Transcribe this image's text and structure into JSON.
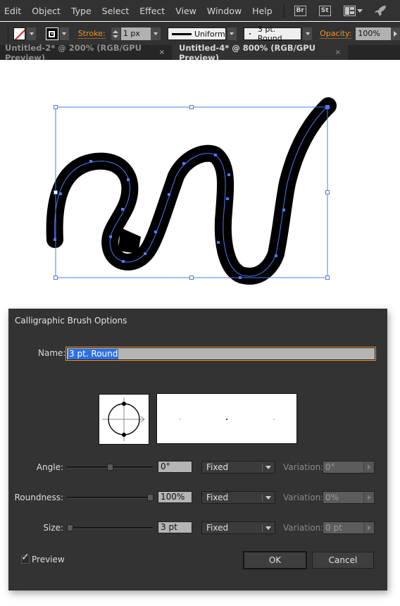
{
  "menubar": {
    "items": [
      "Edit",
      "Object",
      "Type",
      "Select",
      "Effect",
      "View",
      "Window",
      "Help"
    ],
    "app_icons": [
      {
        "name": "bridge-icon",
        "label": "Br"
      },
      {
        "name": "stock-icon",
        "label": "St"
      }
    ],
    "workspace_icon": "workspace-layout-icon",
    "rocket_icon": "rocket-icon"
  },
  "controlbar": {
    "fill_swatch": "none",
    "stroke_label": "Stroke:",
    "stroke_weight": "1 px",
    "profile_label": "Uniform",
    "brush_label": "3 pt. Round",
    "opacity_label": "Opacity:",
    "opacity_value": "100%",
    "accent_color": "#f0962e"
  },
  "tabs": [
    {
      "label": "Untitled-2* @ 200% (RGB/GPU Preview)",
      "active": false,
      "close": "×"
    },
    {
      "label": "Untitled-4* @ 800% (RGB/GPU Preview)",
      "active": true,
      "close": "×"
    }
  ],
  "canvas": {
    "selection_color": "#4a7cf0",
    "stroke_color": "#000000"
  },
  "dialog": {
    "title": "Calligraphic Brush Options",
    "name_label": "Name:",
    "name_value": "3 pt. Round",
    "rows": [
      {
        "label": "Angle:",
        "value": "0°",
        "slider_fraction": 0.5,
        "mode": "Fixed",
        "variation_label": "Variation:",
        "variation_value": "0°"
      },
      {
        "label": "Roundness:",
        "value": "100%",
        "slider_fraction": 1.0,
        "mode": "Fixed",
        "variation_label": "Variation:",
        "variation_value": "0%"
      },
      {
        "label": "Size:",
        "value": "3 pt",
        "slider_fraction": 0.0,
        "mode": "Fixed",
        "variation_label": "Variation:",
        "variation_value": "0 pt"
      }
    ],
    "preview_label": "Preview",
    "preview_checked": true,
    "ok_label": "OK",
    "cancel_label": "Cancel"
  }
}
